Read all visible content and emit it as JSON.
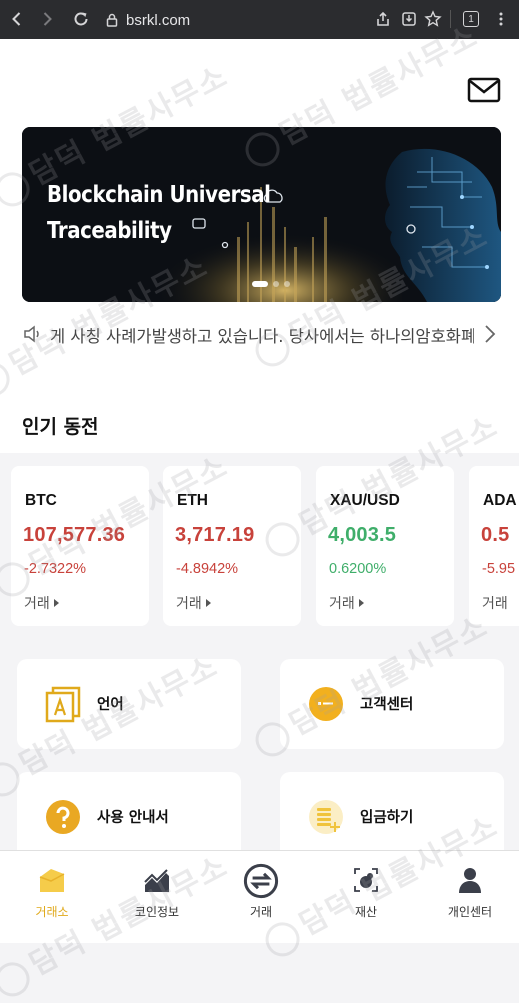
{
  "browser": {
    "url": "bsrkl.com",
    "tab_count": "1"
  },
  "banner": {
    "title_line1": "Blockchain Universal",
    "title_line2": "Traceability"
  },
  "notice": {
    "text": "게 사칭 사례가발생하고 있습니다. 당사에서는 하나의암호화폐"
  },
  "section": {
    "popular_title": "인기 동전"
  },
  "coins": [
    {
      "symbol": "BTC",
      "price": "107,577.36",
      "change": "-2.7322%",
      "trade_label": "거래"
    },
    {
      "symbol": "ETH",
      "price": "3,717.19",
      "change": "-4.8942%",
      "trade_label": "거래"
    },
    {
      "symbol": "XAU/USD",
      "price": "4,003.5",
      "change": "0.6200%",
      "trade_label": "거래"
    },
    {
      "symbol": "ADA",
      "price": "0.5",
      "change": "-5.95",
      "trade_label": "거래"
    }
  ],
  "menu": {
    "language": "언어",
    "customer_center": "고객센터",
    "user_guide": "사용 안내서",
    "deposit": "입금하기"
  },
  "nav": {
    "exchange": "거래소",
    "coin_info": "코인정보",
    "trade": "거래",
    "assets": "재산",
    "profile": "개인센터"
  },
  "watermark": {
    "text": "담덕 법률사무소"
  },
  "colors": {
    "accent": "#e0a91b",
    "down": "#c8423b",
    "up": "#3fae6a"
  }
}
